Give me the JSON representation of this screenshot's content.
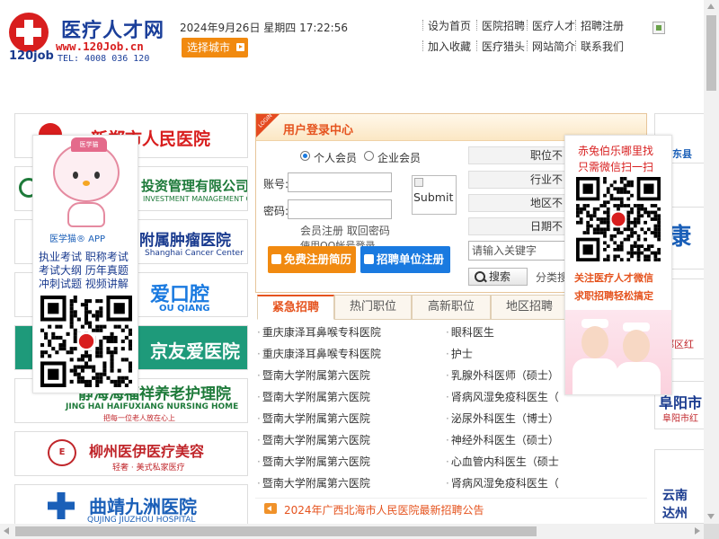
{
  "header": {
    "logo_text": "120job",
    "site_name": "医疗人才网",
    "site_url": "www.120Job.cn",
    "tel": "TEL: 4008 036 120",
    "datetime": "2024年9月26日 星期四 17:22:56",
    "city_button": "选择城市",
    "links_row1": [
      "设为首页",
      "医院招聘",
      "医疗人才",
      "招聘注册"
    ],
    "links_row2": [
      "加入收藏",
      "医疗猎头",
      "网站简介",
      "联系我们"
    ]
  },
  "left_ads": [
    {
      "title": "新郑市人民医院",
      "color": "#d81e1e"
    },
    {
      "title": "投资管理有限公司",
      "sub": "INVESTMENT MANAGEMENT CO.,LTD.",
      "color": "#1e7a3a"
    },
    {
      "title": "附属肿瘤医院",
      "sub": "Shanghai Cancer Center",
      "color": "#1a3b8f"
    },
    {
      "title": "爱口腔",
      "sub": "OU QIANG",
      "color": "#1a7ae0"
    },
    {
      "title": "京友爱医院",
      "color": "#ffffff"
    },
    {
      "title": "静海海福祥养老护理院",
      "sub": "JING HAI HAIFUXIANG NURSING HOME",
      "sub2": "把每一位老人放在心上",
      "color": "#1e7a3a"
    },
    {
      "title": "柳州医伊医疗美容",
      "sub": "轻奢 · 美式私家医疗",
      "color": "#c0262b"
    },
    {
      "title": "曲靖九洲医院",
      "sub": "QUJING JIUZHOU HOSPITAL",
      "color": "#1a5fb8"
    }
  ],
  "float_left": {
    "hat_label": "医学猫",
    "app_label": "医学猫® APP",
    "lines": [
      "执业考试  职称考试",
      "考试大纲  历年真题",
      "冲刺试题  视频讲解"
    ]
  },
  "login": {
    "title": "用户登录中心",
    "ribbon": "LOGIN",
    "member_types": [
      "个人会员",
      "企业会员"
    ],
    "account_label": "账号:",
    "password_label": "密码:",
    "submit_label": "Submit",
    "links": "会员注册 取回密码",
    "qq_login": "使用QQ帐号登录",
    "btn_register": "免费注册简历",
    "btn_employer": "招聘单位注册",
    "selects": [
      "职位不",
      "行业不",
      "地区不",
      "日期不"
    ],
    "keyword_placeholder": "请输入关键字",
    "search_label": "搜索",
    "category_label": "分类搜"
  },
  "tabs": [
    "紧急招聘",
    "热门职位",
    "高新职位",
    "地区招聘"
  ],
  "jobs": [
    {
      "hospital": "重庆康泽耳鼻喉专科医院",
      "position": "眼科医生"
    },
    {
      "hospital": "重庆康泽耳鼻喉专科医院",
      "position": "护士"
    },
    {
      "hospital": "暨南大学附属第六医院",
      "position": "乳腺外科医师（硕士）"
    },
    {
      "hospital": "暨南大学附属第六医院",
      "position": "肾病风湿免疫科医生（"
    },
    {
      "hospital": "暨南大学附属第六医院",
      "position": "泌尿外科医生（博士）"
    },
    {
      "hospital": "暨南大学附属第六医院",
      "position": "神经外科医生（硕士）"
    },
    {
      "hospital": "暨南大学附属第六医院",
      "position": "心血管内科医生（硕士"
    },
    {
      "hospital": "暨南大学附属第六医院",
      "position": "肾病风湿免疫科医生（"
    }
  ],
  "notice": "2024年广西北海市人民医院最新招聘公告",
  "float_right": {
    "line1": "赤兔伯乐哪里找",
    "line2": "只需微信扫一扫",
    "red1": "关注医疗人才微信",
    "red2": "求职招聘轻松搞定"
  },
  "right_ads": [
    "惠东县",
    "康",
    "郑区红",
    "阜阳市",
    "阜阳市红",
    "云南",
    "达州"
  ],
  "colors": {
    "brand_red": "#d81e1e",
    "brand_blue": "#1b3f9a",
    "accent_orange": "#f18a10",
    "tab_red": "#e5531e"
  }
}
